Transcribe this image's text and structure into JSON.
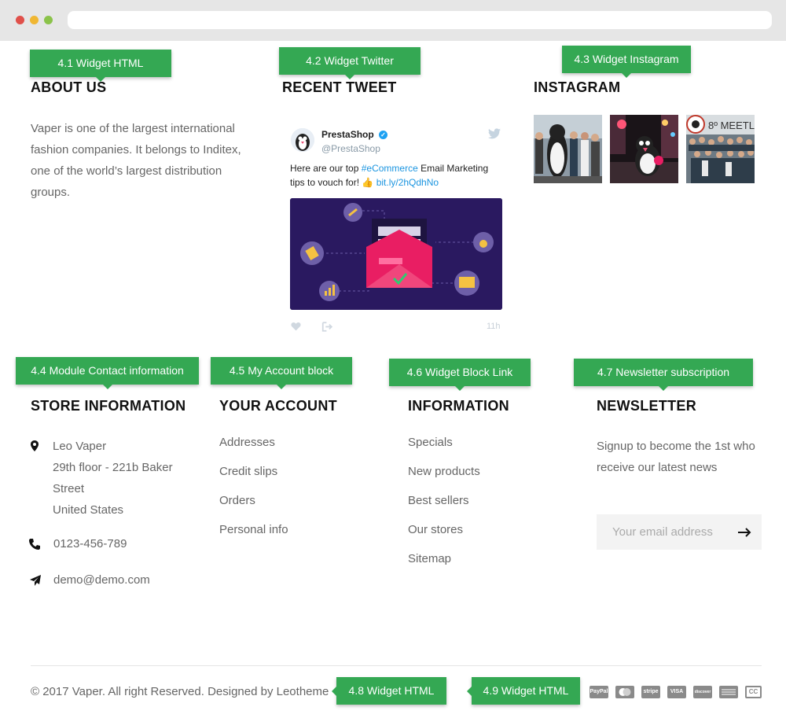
{
  "tags": {
    "t41": "4.1 Widget HTML",
    "t42": "4.2 Widget Twitter",
    "t43": "4.3 Widget Instagram",
    "t44": "4.4 Module Contact information",
    "t45": "4.5 My Account block",
    "t46": "4.6 Widget Block Link",
    "t47": "4.7 Newsletter subscription",
    "t48": "4.8 Widget HTML",
    "t49": "4.9 Widget HTML"
  },
  "about": {
    "title": "ABOUT US",
    "line1": "Vaper is one of the largest international",
    "line2": "fashion companies. It belongs to Inditex,",
    "line3": "one of the world’s largest distribution",
    "line4": "groups."
  },
  "tweet": {
    "title": "RECENT TWEET",
    "name": "PrestaShop",
    "handle": "@PrestaShop",
    "text_before": "Here are our top ",
    "hashtag": "#eCommerce",
    "text_after": " Email Marketing",
    "text_line2": "tips to vouch for! ",
    "link": "bit.ly/2hQdhNo",
    "time": "11h"
  },
  "instagram": {
    "title": "INSTAGRAM"
  },
  "store": {
    "title": "STORE INFORMATION",
    "name": "Leo Vaper",
    "addr1": "29th floor - 221b Baker",
    "addr2": "Street",
    "country": "United States",
    "phone": "0123-456-789",
    "email": "demo@demo.com"
  },
  "account": {
    "title": "YOUR ACCOUNT",
    "items": [
      "Addresses",
      "Credit slips",
      "Orders",
      "Personal info"
    ]
  },
  "information": {
    "title": "INFORMATION",
    "items": [
      "Specials",
      "New products",
      "Best sellers",
      "Our stores",
      "Sitemap"
    ]
  },
  "newsletter": {
    "title": "NEWSLETTER",
    "line1": "Signup to become the 1st who",
    "line2": "receive our latest news",
    "placeholder": "Your email address"
  },
  "footer": {
    "copyright": "© 2017 Vaper. All right Reserved. Designed by Leotheme",
    "payments": [
      "PayPal",
      "Mastercard",
      "stripe",
      "VISA",
      "discover",
      "amex",
      "CC"
    ]
  },
  "colors": {
    "accent": "#34a853",
    "link": "#1b95e0",
    "heading": "#111111",
    "text": "#666666"
  }
}
